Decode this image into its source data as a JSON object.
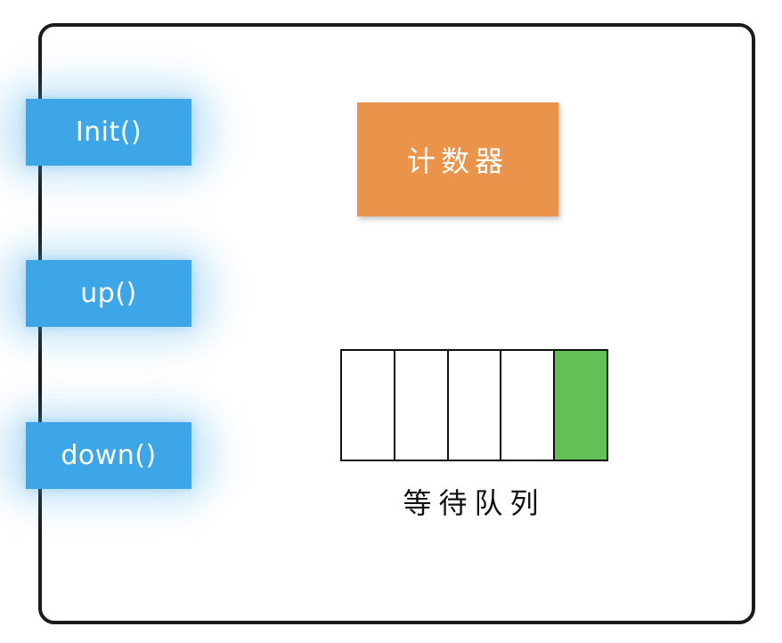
{
  "methods": [
    {
      "label": "Init()"
    },
    {
      "label": "up()"
    },
    {
      "label": "down()"
    }
  ],
  "counter": {
    "label": "计数器",
    "color": "#ea934a"
  },
  "queue": {
    "label": "等待队列",
    "slots": 5,
    "filled_index": 4,
    "filled_color": "#63c057"
  },
  "colors": {
    "method_bg": "#3ca6e6",
    "frame_border": "#1b1b1b"
  }
}
